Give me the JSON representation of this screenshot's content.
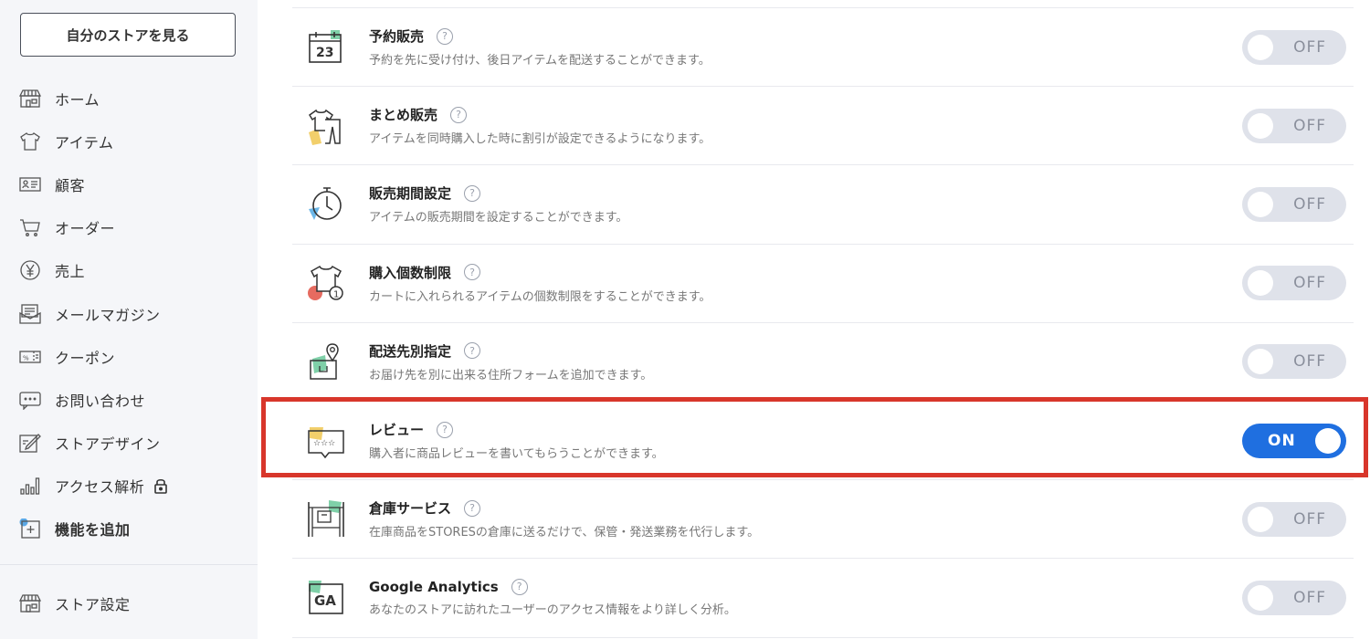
{
  "sidebar": {
    "view_store_label": "自分のストアを見る",
    "items": [
      {
        "label": "ホーム",
        "icon": "store-icon"
      },
      {
        "label": "アイテム",
        "icon": "shirt-icon"
      },
      {
        "label": "顧客",
        "icon": "customer-card-icon"
      },
      {
        "label": "オーダー",
        "icon": "cart-icon"
      },
      {
        "label": "売上",
        "icon": "yen-icon"
      },
      {
        "label": "メールマガジン",
        "icon": "mail-icon"
      },
      {
        "label": "クーポン",
        "icon": "coupon-icon"
      },
      {
        "label": "お問い合わせ",
        "icon": "chat-icon"
      },
      {
        "label": "ストアデザイン",
        "icon": "design-icon"
      },
      {
        "label": "アクセス解析",
        "icon": "bar-chart-icon"
      },
      {
        "label": "機能を追加",
        "icon": "add-feature-icon"
      }
    ],
    "bottom_items": [
      {
        "label": "ストア設定",
        "icon": "store-settings-icon"
      }
    ]
  },
  "features": [
    {
      "title": "予約販売",
      "desc": "予約を先に受け付け、後日アイテムを配送することができます。",
      "state": "OFF",
      "icon": "calendar-23-icon"
    },
    {
      "title": "まとめ販売",
      "desc": "アイテムを同時購入した時に割引が設定できるようになります。",
      "state": "OFF",
      "icon": "bundle-clothes-icon"
    },
    {
      "title": "販売期間設定",
      "desc": "アイテムの販売期間を設定することができます。",
      "state": "OFF",
      "icon": "clock-icon"
    },
    {
      "title": "購入個数制限",
      "desc": "カートに入れられるアイテムの個数制限をすることができます。",
      "state": "OFF",
      "icon": "purchase-limit-icon"
    },
    {
      "title": "配送先別指定",
      "desc": "お届け先を別に出来る住所フォームを追加できます。",
      "state": "OFF",
      "icon": "delivery-pin-icon"
    },
    {
      "title": "レビュー",
      "desc": "購入者に商品レビューを書いてもらうことができます。",
      "state": "ON",
      "icon": "review-stars-icon"
    },
    {
      "title": "倉庫サービス",
      "desc": "在庫商品をSTORESの倉庫に送るだけで、保管・発送業務を代行します。",
      "state": "OFF",
      "icon": "warehouse-icon"
    },
    {
      "title": "Google Analytics",
      "desc": "あなたのストアに訪れたユーザーのアクセス情報をより詳しく分析。",
      "state": "OFF",
      "icon": "ga-icon",
      "icon_text": "GA"
    }
  ],
  "help_glyph": "?",
  "colors": {
    "accent": "#1f6fe0",
    "highlight": "#d8362b",
    "toggle_off": "#dfe2ea",
    "sidebar_bg": "#f5f6f9"
  }
}
